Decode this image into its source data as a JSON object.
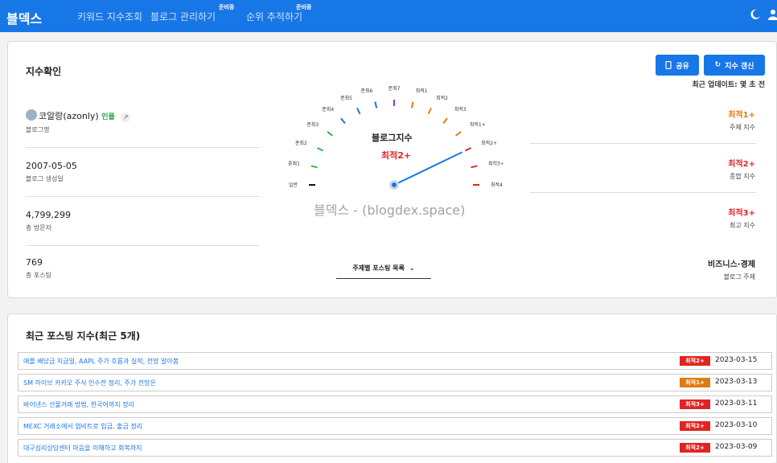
{
  "header": {
    "brand": "블덱스",
    "nav": [
      "키워드 지수조회",
      "블로그 관리하기",
      "순위 추적하기"
    ],
    "soon_badge": "준비중"
  },
  "summary": {
    "title": "지수확인",
    "share_label": "공유",
    "refresh_label": "지수 갱신",
    "updated": "최근 업데이트: 몇 초 전",
    "blog_name": "코알랑(azonly)",
    "blog_badge": "인플",
    "blog_name_label": "블로그명",
    "created": "2007-05-05",
    "created_label": "블로그 생성일",
    "visitors": "4,799,299",
    "visitors_label": "총 방문자",
    "posts": "769",
    "posts_label": "총 포스팅",
    "topic_select": "주제별 포스팅 목록",
    "gauge_title": "블로그지수",
    "gauge_value": "최적2+",
    "watermark": "블덱스 - (blogdex.space)",
    "gauge_ticks": [
      "일반",
      "준최1",
      "준최2",
      "준최3",
      "준최4",
      "준최5",
      "준최6",
      "준최7",
      "최적1",
      "최적2",
      "최적3",
      "최적1+",
      "최적2+",
      "최적3+",
      "최적4+"
    ],
    "theme_index": "최적1+",
    "theme_index_label": "주제 지수",
    "overall_index": "최적2+",
    "overall_index_label": "종합 지수",
    "max_index": "최적3+",
    "max_index_label": "최고 지수",
    "category": "비즈니스·경제",
    "category_label": "블로그 주제",
    "colors": {
      "orange": "#e07b12",
      "red": "#e02424",
      "accent": "#1877e6"
    }
  },
  "recent": {
    "title": "최근 포스팅 지수(최근 5개)",
    "posts": [
      {
        "title": "애플 배당금 지급일, AAPL 주가 흐름과 실적, 전망 알아봄",
        "badge": "최적2+",
        "date": "2023-03-15",
        "color": "#e02424"
      },
      {
        "title": "SM 하이브 카카오 주식 인수전 정리, 주가 전망은",
        "badge": "최적1+",
        "date": "2023-03-13",
        "color": "#e07b12"
      },
      {
        "title": "바이낸스 선물거래 방법, 한국어까지 정리",
        "badge": "최적3+",
        "date": "2023-03-11",
        "color": "#e02424"
      },
      {
        "title": "MEXC 거래소에서 업비트로 입금, 출금 정리",
        "badge": "최적2+",
        "date": "2023-03-10",
        "color": "#e02424"
      },
      {
        "title": "대구심리상담센터 마음을 이해하고 회복까지",
        "badge": "최적2+",
        "date": "2023-03-09",
        "color": "#e02424"
      }
    ]
  }
}
